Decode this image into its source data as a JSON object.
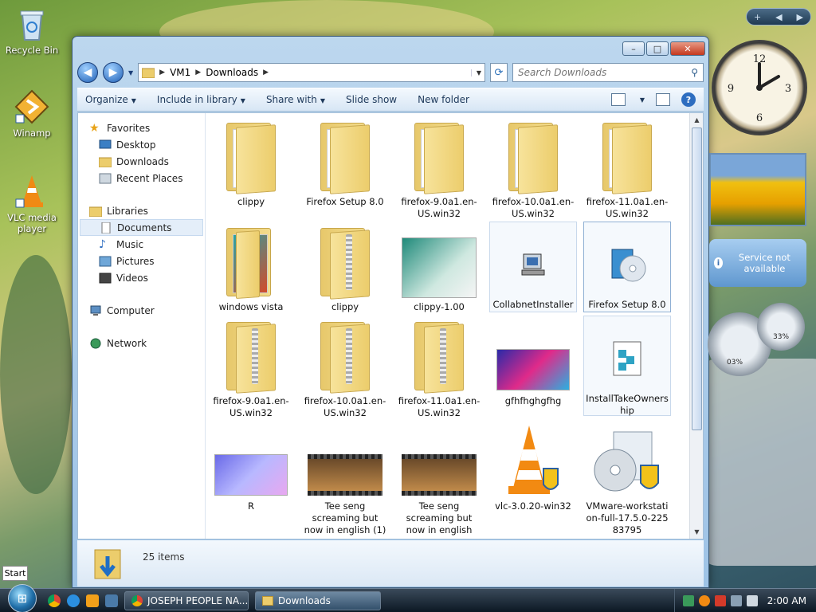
{
  "desktop": {
    "icons": [
      {
        "label": "Recycle Bin"
      },
      {
        "label": "Winamp"
      },
      {
        "label": "VLC media player"
      }
    ]
  },
  "window": {
    "controls": {
      "minimize": "–",
      "maximize": "□",
      "close": "✕"
    },
    "nav": {
      "back": "◀",
      "forward": "▶"
    },
    "address": {
      "crumbs": [
        "VM1",
        "Downloads"
      ]
    },
    "search": {
      "placeholder": "Search Downloads"
    },
    "toolbar": {
      "organize": "Organize",
      "include_in_library": "Include in library",
      "share_with": "Share with",
      "slide_show": "Slide show",
      "new_folder": "New folder",
      "help": "?"
    },
    "nav_pane": {
      "favorites": "Favorites",
      "desktop": "Desktop",
      "downloads": "Downloads",
      "recent_places": "Recent Places",
      "libraries": "Libraries",
      "documents": "Documents",
      "music": "Music",
      "pictures": "Pictures",
      "videos": "Videos",
      "computer": "Computer",
      "network": "Network"
    },
    "files": [
      {
        "name": "clippy",
        "kind": "folder"
      },
      {
        "name": "Firefox Setup 8.0",
        "kind": "folder"
      },
      {
        "name": "firefox-9.0a1.en-US.win32",
        "kind": "folder"
      },
      {
        "name": "firefox-10.0a1.en-US.win32",
        "kind": "folder"
      },
      {
        "name": "firefox-11.0a1.en-US.win32",
        "kind": "folder"
      },
      {
        "name": "windows vista",
        "kind": "folder"
      },
      {
        "name": "clippy",
        "kind": "zip"
      },
      {
        "name": "clippy-1.00",
        "kind": "image"
      },
      {
        "name": "CollabnetInstaller",
        "kind": "exe"
      },
      {
        "name": "Firefox Setup 8.0",
        "kind": "installer"
      },
      {
        "name": "firefox-9.0a1.en-US.win32",
        "kind": "zip"
      },
      {
        "name": "firefox-10.0a1.en-US.win32",
        "kind": "zip"
      },
      {
        "name": "firefox-11.0a1.en-US.win32",
        "kind": "zip"
      },
      {
        "name": "gfhfhghgfhg",
        "kind": "image"
      },
      {
        "name": "InstallTakeOwnership",
        "kind": "reg"
      },
      {
        "name": "R",
        "kind": "image"
      },
      {
        "name": "Tee seng screaming but now in english (1)",
        "kind": "video"
      },
      {
        "name": "Tee seng screaming but now in english",
        "kind": "video"
      },
      {
        "name": "vlc-3.0.20-win32",
        "kind": "vlc"
      },
      {
        "name": "VMware-workstation-full-17.5.0-22583795",
        "kind": "installer"
      }
    ],
    "status": {
      "item_count": "25 items"
    }
  },
  "gadgets": {
    "bar": {
      "add": "+",
      "prev": "◀",
      "next": "▶"
    },
    "weather": {
      "message": "Service not available",
      "info_icon": "i"
    },
    "meters": {
      "cpu": "03%",
      "memory": "33%"
    }
  },
  "taskbar": {
    "start_tip": "Start",
    "tasks": [
      {
        "label": "JOSEPH PEOPLE NA..."
      },
      {
        "label": "Downloads"
      }
    ],
    "clock": "2:00 AM"
  },
  "colors": {
    "accent": "#2d6dc0",
    "folder": "#f0d27a",
    "taskbar": "#1a2a3a"
  }
}
